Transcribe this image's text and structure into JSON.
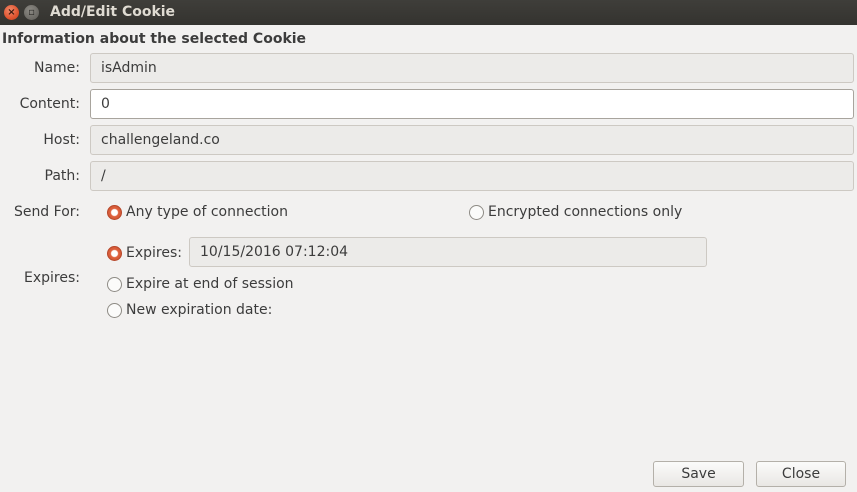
{
  "window": {
    "title": "Add/Edit Cookie",
    "close_glyph": "×",
    "minimize_glyph": "▫"
  },
  "section_title": "Information about the selected Cookie",
  "fields": {
    "name": {
      "label": "Name:",
      "value": "isAdmin"
    },
    "content": {
      "label": "Content:",
      "value": "0"
    },
    "host": {
      "label": "Host:",
      "value": "challengeland.co"
    },
    "path": {
      "label": "Path:",
      "value": "/"
    }
  },
  "send_for": {
    "label": "Send For:",
    "options": [
      {
        "label": "Any type of connection",
        "selected": true
      },
      {
        "label": "Encrypted connections only",
        "selected": false
      }
    ]
  },
  "expires": {
    "label": "Expires:",
    "options": [
      {
        "label": "Expires:",
        "selected": true,
        "value": "10/15/2016 07:12:04"
      },
      {
        "label": "Expire at end of session",
        "selected": false
      },
      {
        "label": "New expiration date:",
        "selected": false
      }
    ]
  },
  "buttons": {
    "save": "Save",
    "close": "Close"
  },
  "colors": {
    "accent": "#e0623e",
    "titlebar": "#3a3935",
    "background": "#f2f1f0"
  }
}
